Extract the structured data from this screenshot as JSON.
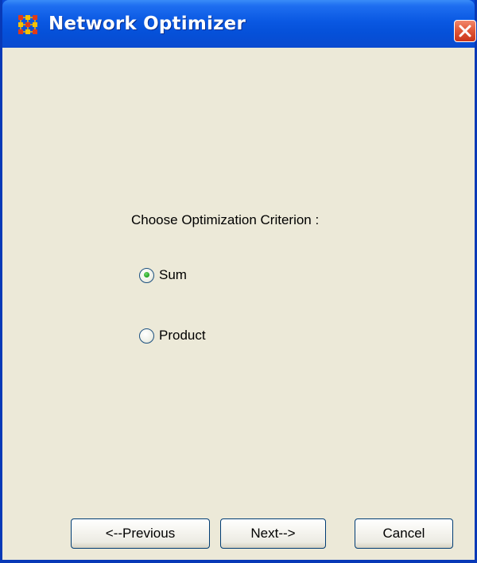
{
  "window": {
    "title": "Network Optimizer",
    "icon": "network-grid-icon",
    "close_icon": "close-icon",
    "accent_color": "#0a58e2",
    "close_color": "#e25a3a",
    "background_color": "#ece9d8"
  },
  "main": {
    "prompt": "Choose Optimization Criterion :",
    "options": [
      {
        "label": "Sum",
        "selected": true
      },
      {
        "label": "Product",
        "selected": false
      }
    ]
  },
  "footer": {
    "previous_label": "<--Previous",
    "next_label": "Next-->",
    "cancel_label": "Cancel"
  }
}
